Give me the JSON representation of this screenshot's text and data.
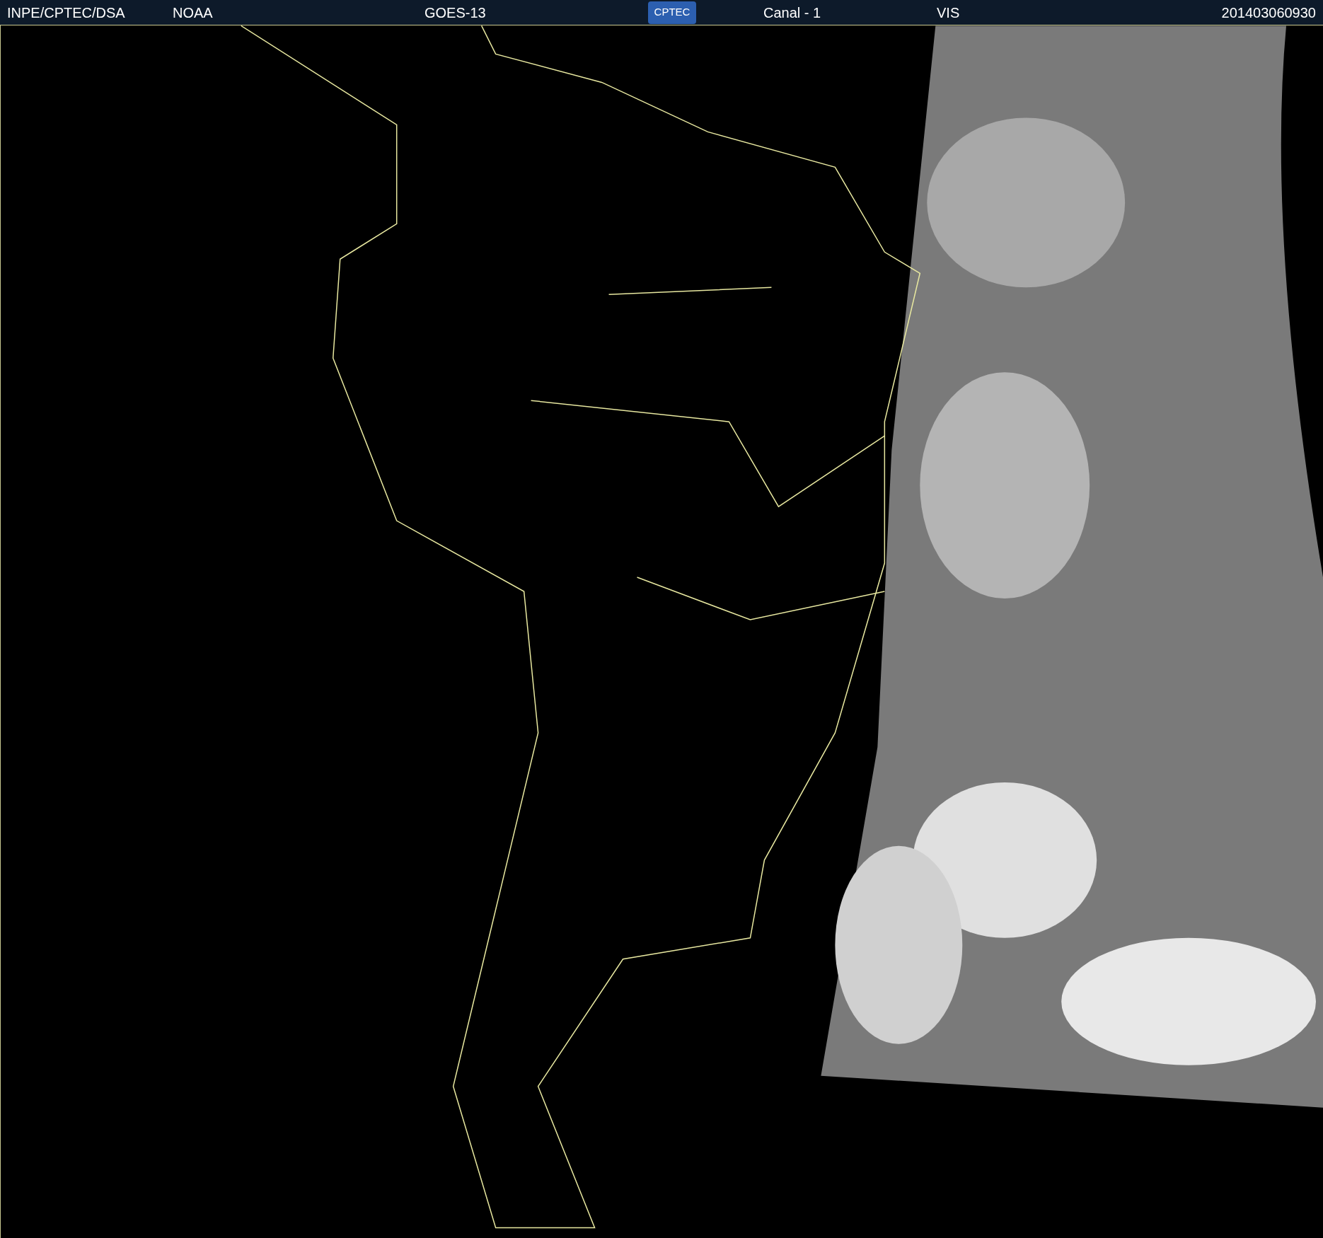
{
  "header": {
    "items": [
      "INPE/CPTEC/DSA",
      "NOAA",
      "GOES-13"
    ],
    "logo_text": "CPTEC",
    "items_right": [
      "Canal - 1",
      "VIS"
    ],
    "timestamp": "201403060930"
  }
}
